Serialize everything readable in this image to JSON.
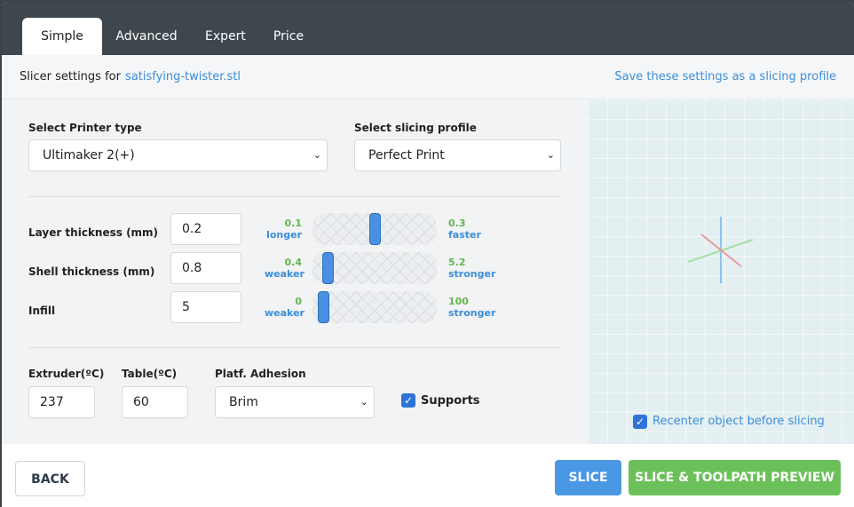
{
  "tabs": [
    {
      "label": "Simple",
      "active": true
    },
    {
      "label": "Advanced",
      "active": false
    },
    {
      "label": "Expert",
      "active": false
    },
    {
      "label": "Price",
      "active": false
    }
  ],
  "header": {
    "slicer_label": "Slicer settings for",
    "filename": "satisfying-twister.stl",
    "save_link": "Save these settings as a slicing profile"
  },
  "printer": {
    "label": "Select Printer type",
    "value": "Ultimaker 2(+)"
  },
  "profile": {
    "label": "Select slicing profile",
    "value": "Perfect Print"
  },
  "settings": [
    {
      "label": "Layer thickness (mm)",
      "value": "0.2",
      "min": "0.1",
      "min_hint": "longer",
      "max": "0.3",
      "max_hint": "faster",
      "level": 0.5
    },
    {
      "label": "Shell thickness (mm)",
      "value": "0.8",
      "min": "0.4",
      "min_hint": "weaker",
      "max": "5.2",
      "max_hint": "stronger",
      "level": 0.083
    },
    {
      "label": "Infill",
      "value": "5",
      "min": "0",
      "min_hint": "weaker",
      "max": "100",
      "max_hint": "stronger",
      "level": 0.05
    }
  ],
  "temps": {
    "extruder_label": "Extruder(ºC)",
    "extruder_value": "237",
    "table_label": "Table(ºC)",
    "table_value": "60"
  },
  "adhesion": {
    "label": "Platf. Adhesion",
    "value": "Brim"
  },
  "supports": {
    "label": "Supports",
    "checked": true
  },
  "preview": {
    "recenter_label": "Recenter object before slicing",
    "recenter_checked": true
  },
  "buttons": {
    "back": "BACK",
    "slice": "SLICE",
    "slice_preview": "SLICE & TOOLPATH PREVIEW"
  },
  "colors": {
    "accent_blue": "#3c8ed8",
    "accent_green": "#62b54e",
    "header_dark": "#3e474e"
  }
}
